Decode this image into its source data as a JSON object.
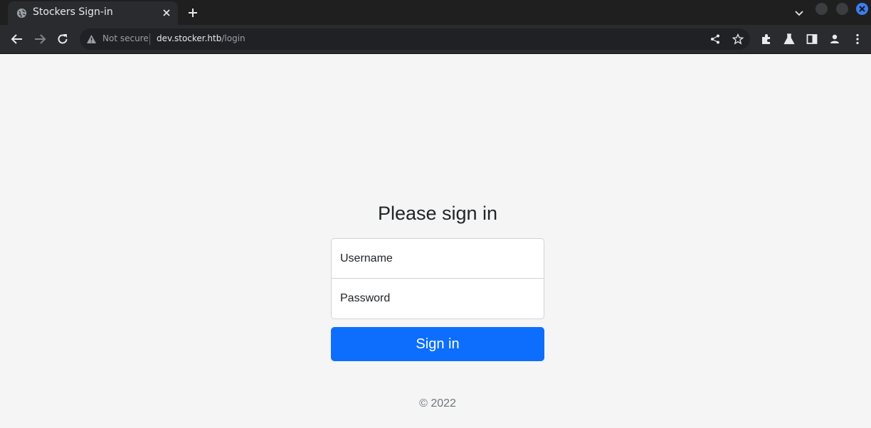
{
  "browser": {
    "tab": {
      "title": "Stockers Sign-in",
      "favicon": "globe-icon"
    },
    "omnibox": {
      "security_label": "Not secure",
      "url_host": "dev.stocker.htb",
      "url_path": "/login"
    },
    "accent_color": "#3f7ee8"
  },
  "page": {
    "heading": "Please sign in",
    "username_placeholder": "Username",
    "password_placeholder": "Password",
    "submit_label": "Sign in",
    "footer": "© 2022",
    "button_color": "#0d6efd",
    "background_color": "#f5f5f5"
  }
}
